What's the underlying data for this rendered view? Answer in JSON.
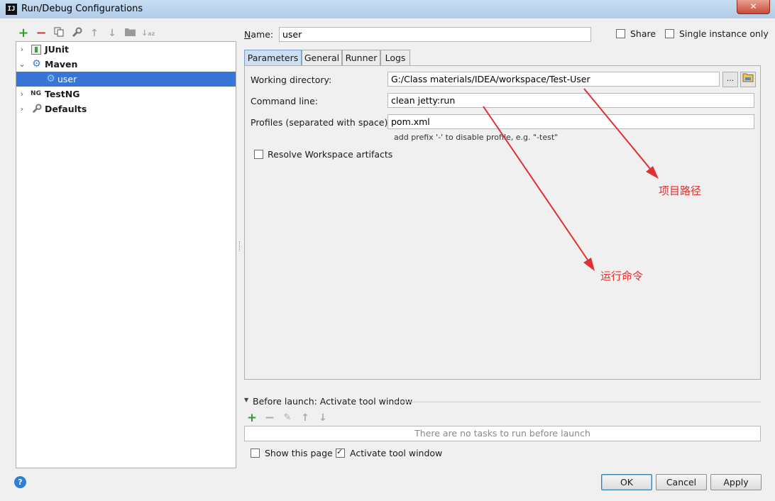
{
  "window": {
    "title": "Run/Debug Configurations",
    "app_icon_text": "IJ",
    "close_glyph": "✕"
  },
  "toolbar": {
    "icons": [
      "add-icon",
      "remove-icon",
      "copy-icon",
      "edit-defaults-icon",
      "move-up-icon",
      "move-down-icon",
      "folder-icon",
      "sort-icon"
    ],
    "add_color": "#2e9e2e",
    "remove_color": "#c83a3a"
  },
  "tree": {
    "items": [
      {
        "label": "JUnit"
      },
      {
        "label": "Maven"
      },
      {
        "label": "user"
      },
      {
        "label": "TestNG"
      },
      {
        "label": "Defaults"
      }
    ]
  },
  "name": {
    "label": "Name:",
    "value": "user"
  },
  "share": {
    "label": "Share",
    "checked": false
  },
  "single_instance": {
    "label": "Single instance only",
    "checked": false
  },
  "tabs": [
    "Parameters",
    "General",
    "Runner",
    "Logs"
  ],
  "params": {
    "working_dir_label": "Working directory:",
    "working_dir_value": "G:/Class materials/IDEA/workspace/Test-User",
    "browse_label": "...",
    "command_line_label": "Command line:",
    "command_line_value": "clean jetty:run",
    "profiles_label": "Profiles (separated with space):",
    "profiles_value": "pom.xml",
    "profiles_hint": "add prefix '-' to disable profile, e.g. \"-test\"",
    "resolve_label": "Resolve Workspace artifacts",
    "resolve_checked": false
  },
  "annotations": {
    "project_path": "项目路径",
    "run_command": "运行命令",
    "color": "#e03030"
  },
  "before_launch": {
    "title": "Before launch: Activate tool window",
    "empty_text": "There are no tasks to run before launch",
    "show_page_label": "Show this page",
    "show_page_checked": false,
    "activate_label": "Activate tool window",
    "activate_checked": true
  },
  "buttons": {
    "ok": "OK",
    "cancel": "Cancel",
    "apply": "Apply",
    "help": "?"
  }
}
